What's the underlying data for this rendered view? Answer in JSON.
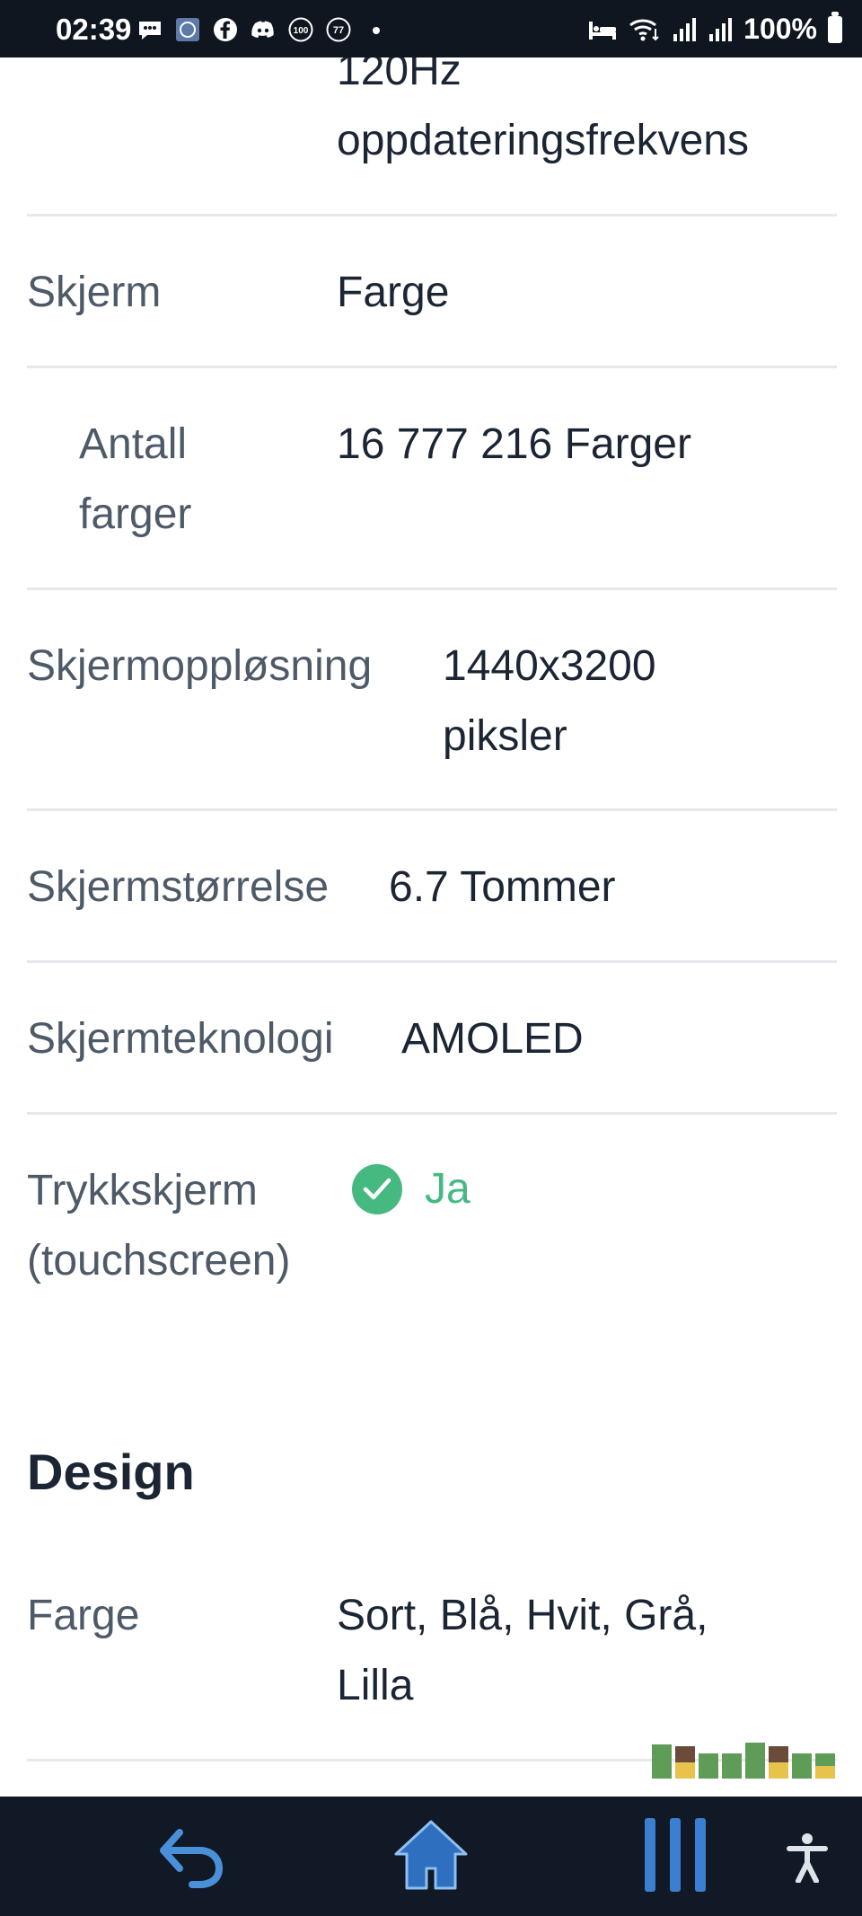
{
  "status": {
    "time": "02:39",
    "battery": "100%",
    "icons": [
      "chat-bubble-icon",
      "app-icon",
      "facebook-icon",
      "discord-icon",
      "badge-100-icon",
      "badge-77-icon",
      "dot-icon",
      "bed-icon",
      "wifi-icon",
      "signal-icon",
      "signal-icon-2",
      "battery-icon"
    ]
  },
  "specs": {
    "refresh_line1": "120Hz",
    "refresh_line2": "oppdateringsfrekvens",
    "skjerm_label": "Skjerm",
    "skjerm_value": "Farge",
    "antall_label_1": "Antall",
    "antall_label_2": "farger",
    "antall_value": "16 777 216 Farger",
    "opplosning_label": "Skjermoppløsning",
    "opplosning_value_1": "1440x3200",
    "opplosning_value_2": "piksler",
    "storrelse_label": "Skjermstørrelse",
    "storrelse_value": "6.7 Tommer",
    "teknologi_label": "Skjermteknologi",
    "teknologi_value": "AMOLED",
    "trykk_label_1": "Trykkskjerm",
    "trykk_label_2": "(touchscreen)",
    "trykk_value": "Ja"
  },
  "design": {
    "title": "Design",
    "farge_label": "Farge",
    "farge_value_1": "Sort, Blå, Hvit, Grå,",
    "farge_value_2": "Lilla"
  },
  "colors": {
    "accent_green": "#46b981",
    "label_gray": "#4e5a68",
    "value_dark": "#1b2533",
    "nav_bg": "#111826",
    "status_bg": "#0f1620"
  },
  "nav": {
    "back": "back-icon",
    "home": "home-icon",
    "recents": "recents-icon",
    "accessibility": "accessibility-icon"
  }
}
